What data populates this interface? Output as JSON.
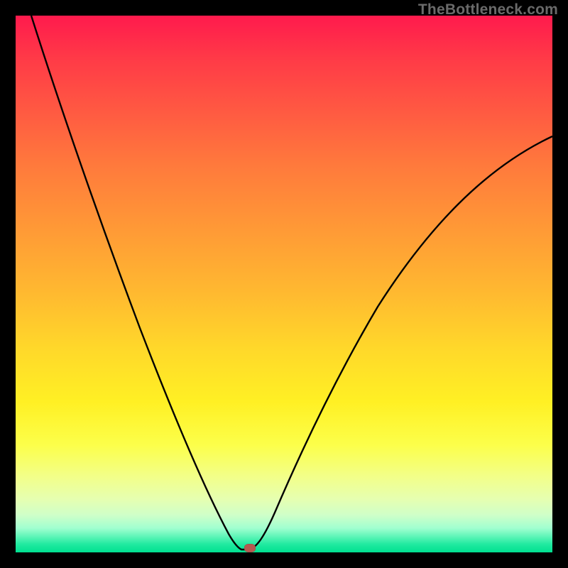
{
  "watermark": "TheBottleneck.com",
  "chart_data": {
    "type": "line",
    "title": "",
    "xlabel": "",
    "ylabel": "",
    "xlim": [
      0,
      100
    ],
    "ylim": [
      0,
      100
    ],
    "grid": false,
    "legend": false,
    "series": [
      {
        "name": "curve",
        "x": [
          3,
          6,
          10,
          14,
          18,
          22,
          26,
          30,
          34,
          36,
          38,
          40,
          41,
          42,
          43,
          44,
          46,
          48,
          52,
          58,
          64,
          72,
          80,
          90,
          100
        ],
        "y": [
          100,
          92,
          82,
          72,
          62,
          52,
          42,
          32,
          22,
          16,
          10,
          5,
          2,
          0.5,
          0.5,
          2,
          6,
          12,
          22,
          34,
          45,
          55,
          63,
          71,
          78
        ]
      }
    ],
    "flat_segment": {
      "x_start": 41,
      "x_end": 43,
      "y": 0.5
    },
    "marker": {
      "x": 43,
      "y": 0.5,
      "color": "#b55a50"
    },
    "background_gradient": {
      "top": "#ff1a4d",
      "mid": "#fff024",
      "bottom": "#00e090"
    },
    "frame_color": "#000000"
  }
}
